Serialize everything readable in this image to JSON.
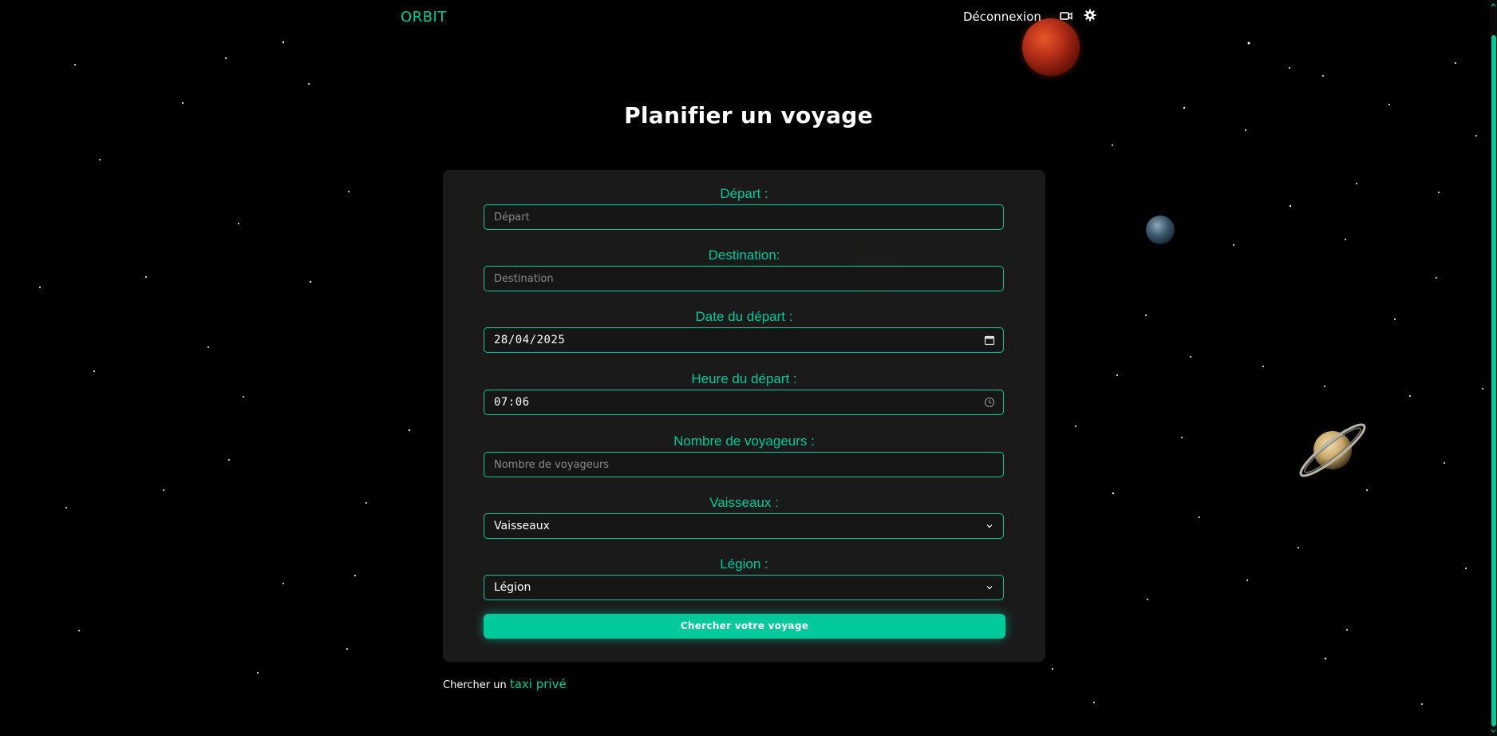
{
  "header": {
    "brand": "ORBIT",
    "logout_label": "Déconnexion",
    "icons": [
      "camera-icon",
      "gear-icon"
    ]
  },
  "page_title": "Planifier un voyage",
  "form": {
    "depart": {
      "label": "Départ :",
      "placeholder": "Départ"
    },
    "destination": {
      "label": "Destination:",
      "placeholder": "Destination"
    },
    "date": {
      "label": "Date du départ :",
      "value": "28/04/2025"
    },
    "time": {
      "label": "Heure du départ :",
      "value": "07:06"
    },
    "travelers": {
      "label": "Nombre de voyageurs :",
      "placeholder": "Nombre de voyageurs"
    },
    "ships": {
      "label": "Vaisseaux :",
      "selected": "Vaisseaux"
    },
    "legion": {
      "label": "Légion :",
      "selected": "Légion"
    },
    "submit_label": "Chercher votre voyage"
  },
  "taxi": {
    "prefix": "Chercher un ",
    "link": "taxi privé"
  },
  "colors": {
    "accent": "#00c99b",
    "background": "#000000",
    "card": "#1c1c1c"
  }
}
